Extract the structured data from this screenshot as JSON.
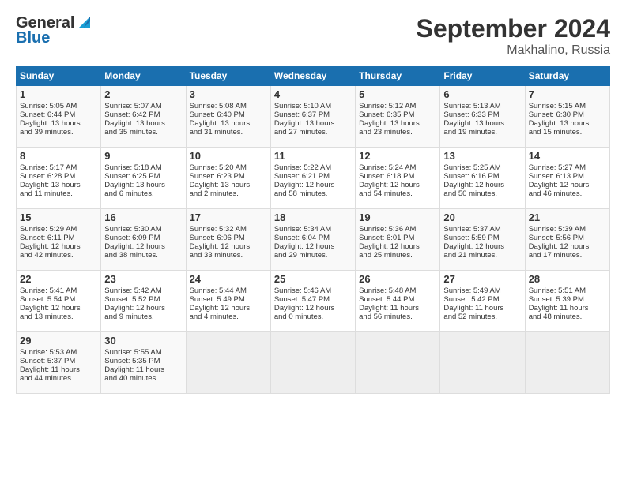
{
  "header": {
    "logo_line1": "General",
    "logo_line2": "Blue",
    "month_title": "September 2024",
    "location": "Makhalino, Russia"
  },
  "days_of_week": [
    "Sunday",
    "Monday",
    "Tuesday",
    "Wednesday",
    "Thursday",
    "Friday",
    "Saturday"
  ],
  "weeks": [
    [
      {
        "day": "1",
        "content": "Sunrise: 5:05 AM\nSunset: 6:44 PM\nDaylight: 13 hours\nand 39 minutes."
      },
      {
        "day": "2",
        "content": "Sunrise: 5:07 AM\nSunset: 6:42 PM\nDaylight: 13 hours\nand 35 minutes."
      },
      {
        "day": "3",
        "content": "Sunrise: 5:08 AM\nSunset: 6:40 PM\nDaylight: 13 hours\nand 31 minutes."
      },
      {
        "day": "4",
        "content": "Sunrise: 5:10 AM\nSunset: 6:37 PM\nDaylight: 13 hours\nand 27 minutes."
      },
      {
        "day": "5",
        "content": "Sunrise: 5:12 AM\nSunset: 6:35 PM\nDaylight: 13 hours\nand 23 minutes."
      },
      {
        "day": "6",
        "content": "Sunrise: 5:13 AM\nSunset: 6:33 PM\nDaylight: 13 hours\nand 19 minutes."
      },
      {
        "day": "7",
        "content": "Sunrise: 5:15 AM\nSunset: 6:30 PM\nDaylight: 13 hours\nand 15 minutes."
      }
    ],
    [
      {
        "day": "8",
        "content": "Sunrise: 5:17 AM\nSunset: 6:28 PM\nDaylight: 13 hours\nand 11 minutes."
      },
      {
        "day": "9",
        "content": "Sunrise: 5:18 AM\nSunset: 6:25 PM\nDaylight: 13 hours\nand 6 minutes."
      },
      {
        "day": "10",
        "content": "Sunrise: 5:20 AM\nSunset: 6:23 PM\nDaylight: 13 hours\nand 2 minutes."
      },
      {
        "day": "11",
        "content": "Sunrise: 5:22 AM\nSunset: 6:21 PM\nDaylight: 12 hours\nand 58 minutes."
      },
      {
        "day": "12",
        "content": "Sunrise: 5:24 AM\nSunset: 6:18 PM\nDaylight: 12 hours\nand 54 minutes."
      },
      {
        "day": "13",
        "content": "Sunrise: 5:25 AM\nSunset: 6:16 PM\nDaylight: 12 hours\nand 50 minutes."
      },
      {
        "day": "14",
        "content": "Sunrise: 5:27 AM\nSunset: 6:13 PM\nDaylight: 12 hours\nand 46 minutes."
      }
    ],
    [
      {
        "day": "15",
        "content": "Sunrise: 5:29 AM\nSunset: 6:11 PM\nDaylight: 12 hours\nand 42 minutes."
      },
      {
        "day": "16",
        "content": "Sunrise: 5:30 AM\nSunset: 6:09 PM\nDaylight: 12 hours\nand 38 minutes."
      },
      {
        "day": "17",
        "content": "Sunrise: 5:32 AM\nSunset: 6:06 PM\nDaylight: 12 hours\nand 33 minutes."
      },
      {
        "day": "18",
        "content": "Sunrise: 5:34 AM\nSunset: 6:04 PM\nDaylight: 12 hours\nand 29 minutes."
      },
      {
        "day": "19",
        "content": "Sunrise: 5:36 AM\nSunset: 6:01 PM\nDaylight: 12 hours\nand 25 minutes."
      },
      {
        "day": "20",
        "content": "Sunrise: 5:37 AM\nSunset: 5:59 PM\nDaylight: 12 hours\nand 21 minutes."
      },
      {
        "day": "21",
        "content": "Sunrise: 5:39 AM\nSunset: 5:56 PM\nDaylight: 12 hours\nand 17 minutes."
      }
    ],
    [
      {
        "day": "22",
        "content": "Sunrise: 5:41 AM\nSunset: 5:54 PM\nDaylight: 12 hours\nand 13 minutes."
      },
      {
        "day": "23",
        "content": "Sunrise: 5:42 AM\nSunset: 5:52 PM\nDaylight: 12 hours\nand 9 minutes."
      },
      {
        "day": "24",
        "content": "Sunrise: 5:44 AM\nSunset: 5:49 PM\nDaylight: 12 hours\nand 4 minutes."
      },
      {
        "day": "25",
        "content": "Sunrise: 5:46 AM\nSunset: 5:47 PM\nDaylight: 12 hours\nand 0 minutes."
      },
      {
        "day": "26",
        "content": "Sunrise: 5:48 AM\nSunset: 5:44 PM\nDaylight: 11 hours\nand 56 minutes."
      },
      {
        "day": "27",
        "content": "Sunrise: 5:49 AM\nSunset: 5:42 PM\nDaylight: 11 hours\nand 52 minutes."
      },
      {
        "day": "28",
        "content": "Sunrise: 5:51 AM\nSunset: 5:39 PM\nDaylight: 11 hours\nand 48 minutes."
      }
    ],
    [
      {
        "day": "29",
        "content": "Sunrise: 5:53 AM\nSunset: 5:37 PM\nDaylight: 11 hours\nand 44 minutes."
      },
      {
        "day": "30",
        "content": "Sunrise: 5:55 AM\nSunset: 5:35 PM\nDaylight: 11 hours\nand 40 minutes."
      },
      {
        "day": "",
        "content": ""
      },
      {
        "day": "",
        "content": ""
      },
      {
        "day": "",
        "content": ""
      },
      {
        "day": "",
        "content": ""
      },
      {
        "day": "",
        "content": ""
      }
    ]
  ]
}
